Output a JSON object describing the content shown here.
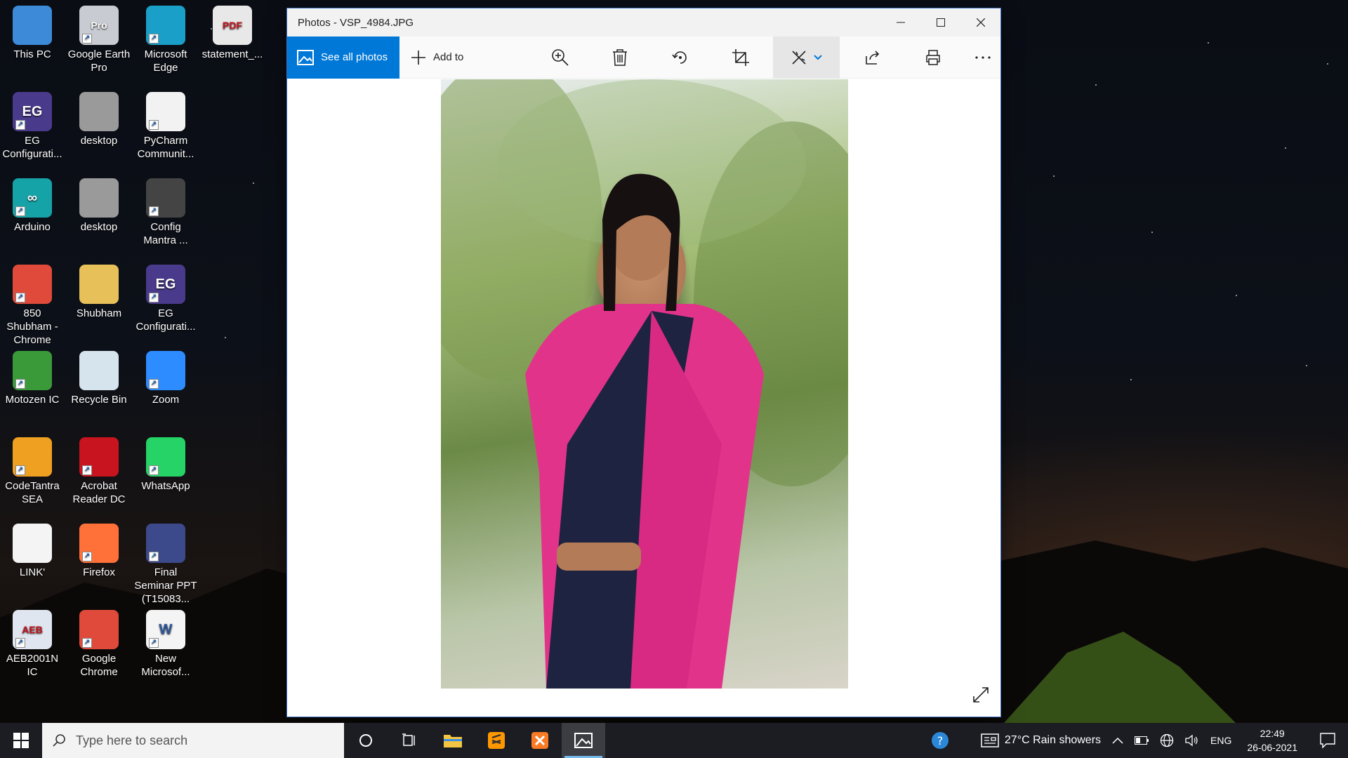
{
  "desktop": {
    "icons": [
      {
        "label": "This PC",
        "icon": "this-pc-icon"
      },
      {
        "label": "Google Earth Pro",
        "icon": "google-earth-pro-icon",
        "badge": "Pro"
      },
      {
        "label": "Microsoft Edge",
        "icon": "edge-icon"
      },
      {
        "label": "statement_...",
        "icon": "pdf-file-icon",
        "badge": "PDF"
      },
      {
        "label": "EG Configurati...",
        "icon": "eg-config-icon",
        "badge": "EG"
      },
      {
        "label": "desktop",
        "icon": "desktop-ini-icon"
      },
      {
        "label": "PyCharm Communit...",
        "icon": "pycharm-file-icon"
      },
      {
        "label": "Arduino",
        "icon": "arduino-icon",
        "badge": "∞"
      },
      {
        "label": "desktop",
        "icon": "desktop-ini-icon"
      },
      {
        "label": "Config Mantra ...",
        "icon": "config-mantra-icon"
      },
      {
        "label": "850 Shubham - Chrome",
        "icon": "chrome-profile-icon"
      },
      {
        "label": "Shubham",
        "icon": "user-folder-icon"
      },
      {
        "label": "EG Configurati...",
        "icon": "eg-config-icon",
        "badge": "EG"
      },
      {
        "label": "Motozen IC",
        "icon": "motozen-icon"
      },
      {
        "label": "Recycle Bin",
        "icon": "recycle-bin-icon"
      },
      {
        "label": "Zoom",
        "icon": "zoom-icon"
      },
      {
        "label": "CodeTantra SEA",
        "icon": "codetantra-icon"
      },
      {
        "label": "Acrobat Reader DC",
        "icon": "acrobat-icon"
      },
      {
        "label": "WhatsApp",
        "icon": "whatsapp-icon"
      },
      {
        "label": "LINK'",
        "icon": "blank-file-icon"
      },
      {
        "label": "Firefox",
        "icon": "firefox-icon"
      },
      {
        "label": "Final Seminar PPT (T15083...",
        "icon": "powerpoint-file-icon"
      },
      {
        "label": "AEB2001N IC",
        "icon": "aeb-icon",
        "badge": "AEB"
      },
      {
        "label": "Google Chrome",
        "icon": "chrome-icon"
      },
      {
        "label": "New Microsof...",
        "icon": "word-file-icon",
        "badge": "W"
      }
    ]
  },
  "window": {
    "title": "Photos - VSP_4984.JPG",
    "toolbar": {
      "see_all_label": "See all photos",
      "add_to_label": "Add to",
      "tools": [
        "zoom-in-icon",
        "delete-icon",
        "rotate-icon",
        "crop-icon",
        "edit-icon",
        "share-icon",
        "print-icon",
        "more-icon"
      ]
    }
  },
  "taskbar": {
    "search_placeholder": "Type here to search",
    "weather": "27°C  Rain showers",
    "language": "ENG",
    "time": "22:49",
    "date": "26-06-2021"
  },
  "colors": {
    "accent": "#0078d7",
    "taskbar": "#1b1d22"
  }
}
